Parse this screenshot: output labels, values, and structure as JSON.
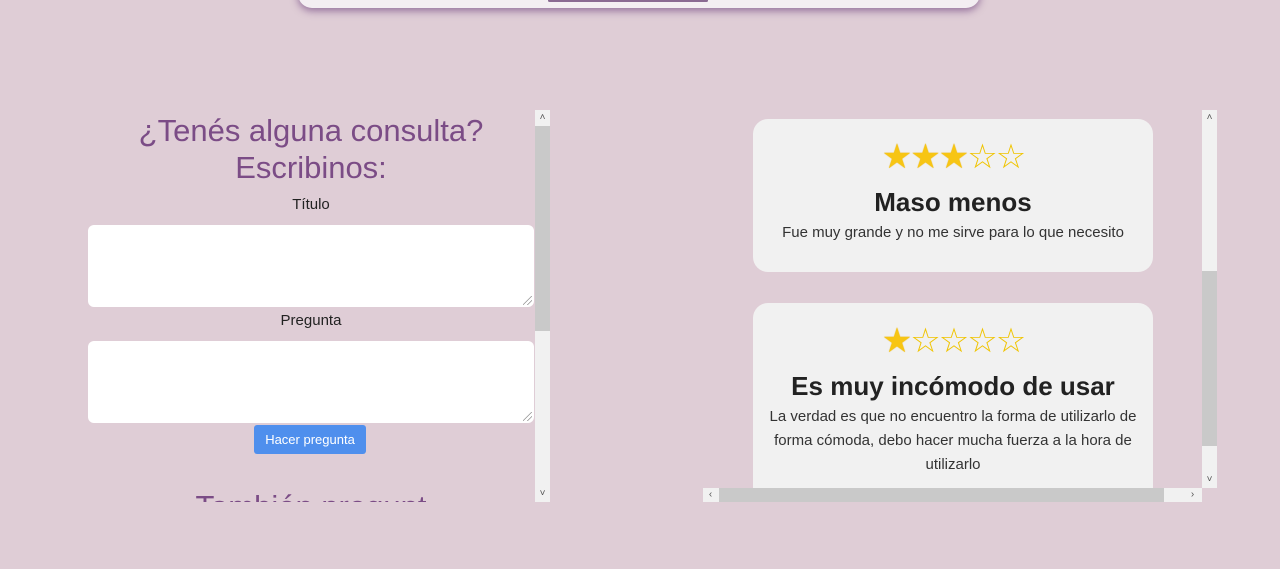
{
  "contact": {
    "title": "¿Tenés alguna consulta? Escribinos:",
    "title_label": "Título",
    "question_label": "Pregunta",
    "submit_label": "Hacer pregunta",
    "next_section_title": "También pregunt"
  },
  "reviews": [
    {
      "rating": 3,
      "rating_max": 5,
      "title": "Maso menos",
      "text": "Fue muy grande y no me sirve para lo que necesito"
    },
    {
      "rating": 1,
      "rating_max": 5,
      "title": "Es muy incómodo de usar",
      "text": "La verdad es que no encuentro la forma de utilizarlo de forma cómoda, debo hacer mucha fuerza a la hora de utilizarlo"
    }
  ],
  "colors": {
    "background": "#dfcdd6",
    "heading": "#7b4c86",
    "button": "#4f8fed",
    "star": "#f7c514",
    "card": "#f1f1f1"
  },
  "icons": {
    "star_full": "★",
    "star_empty": "☆",
    "scroll_up": "˄",
    "scroll_down": "˅",
    "scroll_left": "‹",
    "scroll_right": "›"
  }
}
